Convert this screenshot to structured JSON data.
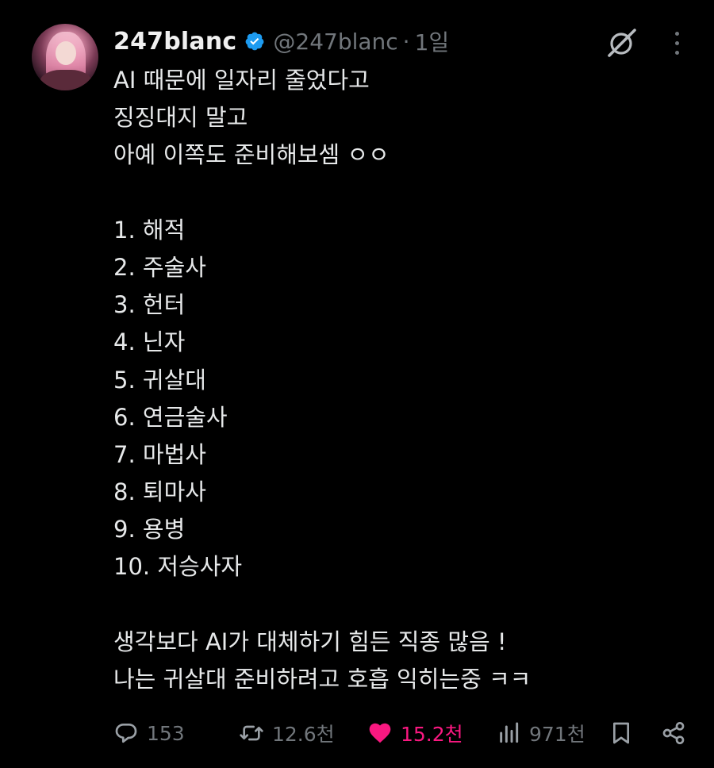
{
  "user": {
    "name": "247blanc",
    "handle": "@247blanc",
    "separator": "·",
    "time": "1일",
    "verified": true,
    "verified_color": "#1d9bf0"
  },
  "tweet": {
    "lines": [
      "AI 때문에 일자리 줄었다고",
      "징징대지 말고",
      "아예 이쪽도 준비해보셈 ㅇㅇ",
      "",
      "1. 해적",
      "2. 주술사",
      "3. 헌터",
      "4. 닌자",
      "5. 귀살대",
      "6. 연금술사",
      "7. 마법사",
      "8. 퇴마사",
      "9. 용병",
      "10. 저승사자",
      "",
      "생각보다 AI가 대체하기 힘든 직종 많음 !",
      "나는 귀살대 준비하려고 호흡 익히는중 ㅋㅋ"
    ]
  },
  "actions": {
    "replies": "153",
    "retweets": "12.6천",
    "likes": "15.2천",
    "views": "971천",
    "like_color": "#f91880",
    "muted_color": "#71767b"
  },
  "icons": {
    "grok": "grok-icon",
    "more": "more-icon",
    "reply": "reply-icon",
    "retweet": "retweet-icon",
    "like": "heart-icon",
    "views": "views-icon",
    "bookmark": "bookmark-icon",
    "share": "share-icon"
  }
}
